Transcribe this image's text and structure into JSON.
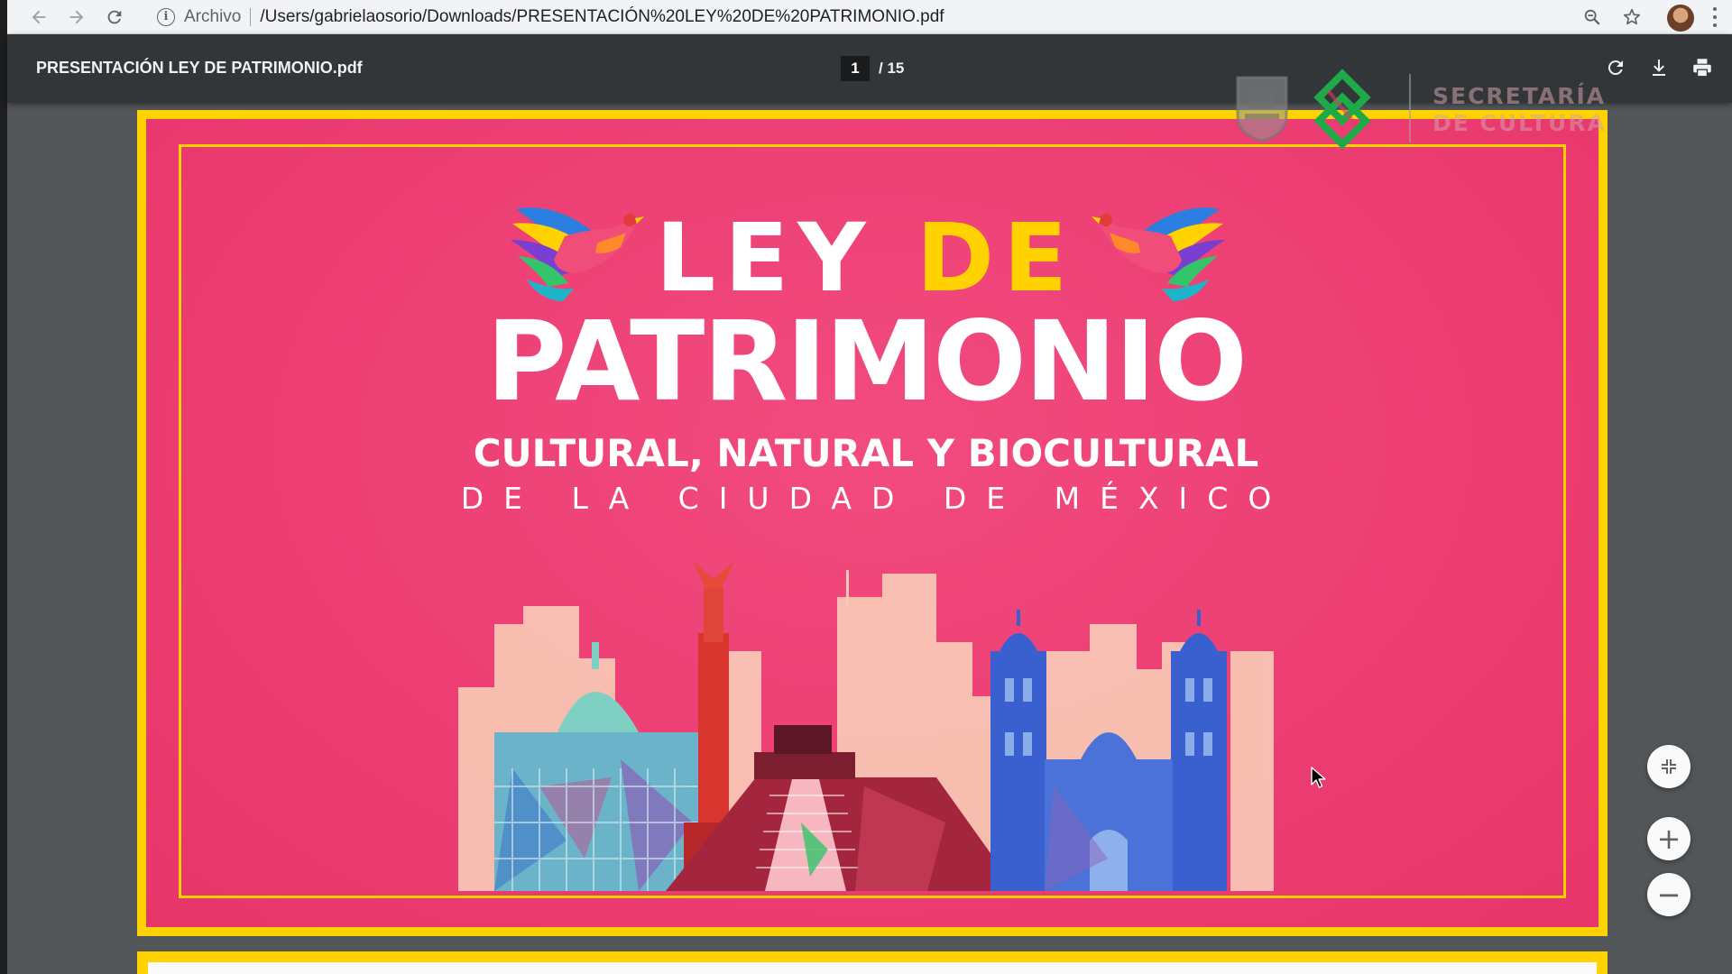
{
  "browser": {
    "back_icon": "arrow-back-icon",
    "forward_icon": "arrow-forward-icon",
    "reload_icon": "reload-icon",
    "scheme_label": "Archivo",
    "url": "/Users/gabrielaosorio/Downloads/PRESENTACIÓN%20LEY%20DE%20PATRIMONIO.pdf",
    "zoom_icon": "zoom-icon",
    "bookmark_icon": "star-icon",
    "menu_icon": "kebab-menu-icon"
  },
  "pdf_toolbar": {
    "file_name": "PRESENTACIÓN LEY DE PATRIMONIO.pdf",
    "current_page": "1",
    "total_pages": "/ 15",
    "rotate_icon": "rotate-icon",
    "download_icon": "download-icon",
    "print_icon": "print-icon"
  },
  "document": {
    "logo_text_line1": "SECRETARÍA",
    "logo_text_line2": "DE CULTURA",
    "title_word1": "LEY",
    "title_word2": "DE",
    "title_word3": "PATRIMONIO",
    "subtitle_line1": "CULTURAL, NATURAL Y BIOCULTURAL",
    "subtitle_line2": "DE LA CIUDAD DE MÉXICO",
    "colors": {
      "frame": "#ffd200",
      "background": "#ec3d72",
      "title": "#ffffff",
      "accent": "#ffd200"
    }
  },
  "zoom_controls": {
    "fit_icon": "fit-to-page-icon",
    "zoom_in": "+",
    "zoom_out": "−"
  }
}
